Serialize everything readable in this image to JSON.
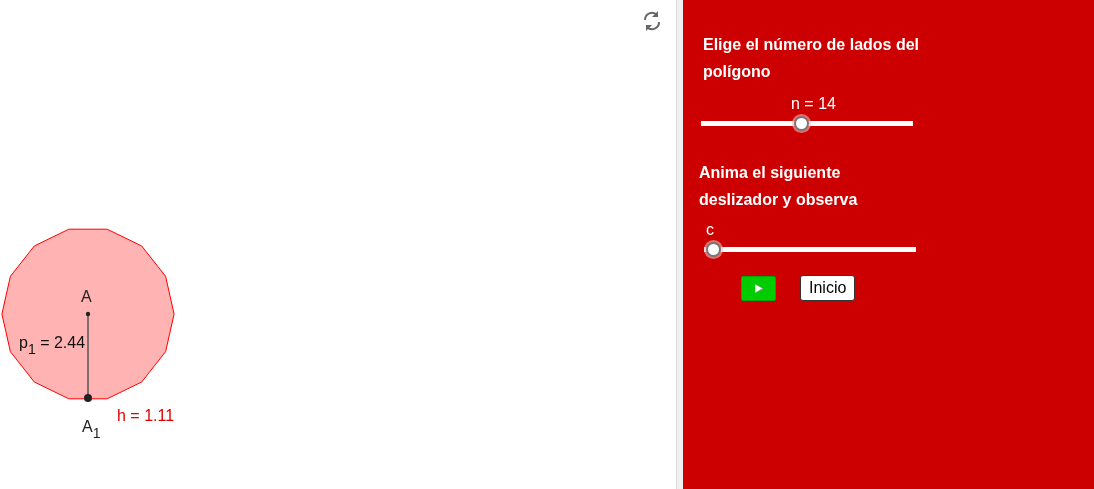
{
  "canvas": {
    "labels": [
      {
        "kind": "point",
        "text": "A"
      },
      {
        "kind": "value",
        "text": "p$_{1}$ = 2.44"
      },
      {
        "kind": "point",
        "text": "A$_{1}$"
      },
      {
        "kind": "measure",
        "text": "h = 1.11"
      }
    ]
  },
  "panel": {
    "heading": "Elige el número de lados del polígono",
    "slider_n": {
      "label": "n = 14",
      "level": 0.47
    },
    "instruction": "Anima el siguiente deslizador y observa",
    "slider_c": {
      "label": "c",
      "level": 0
    },
    "buttons": [
      {
        "kind": "play"
      },
      {
        "kind": "text",
        "label": "Inicio"
      }
    ]
  }
}
